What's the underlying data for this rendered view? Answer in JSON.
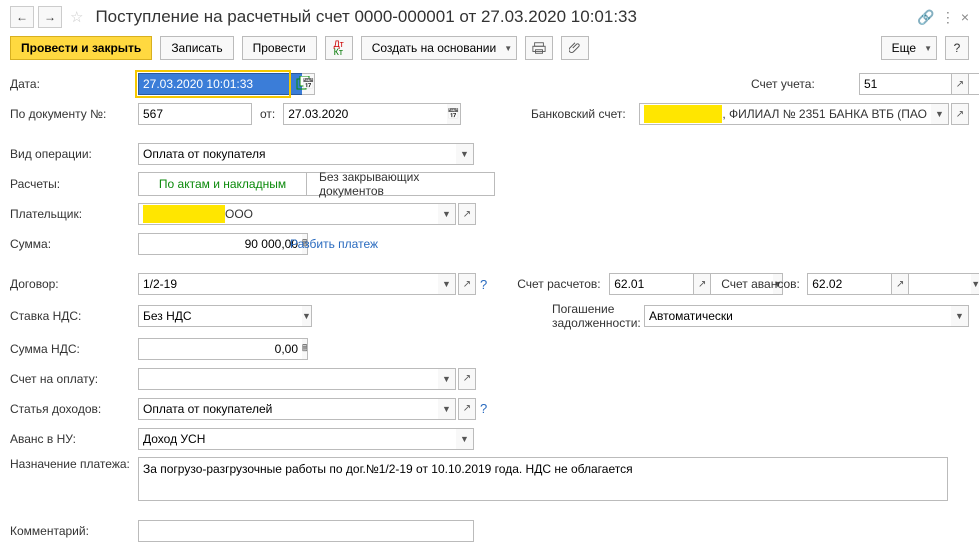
{
  "header": {
    "title": "Поступление на расчетный счет 0000-000001 от 27.03.2020 10:01:33"
  },
  "toolbar": {
    "post_close": "Провести и закрыть",
    "save": "Записать",
    "post": "Провести",
    "create_based": "Создать на основании",
    "more": "Еще"
  },
  "labels": {
    "date": "Дата:",
    "doc_no": "По документу №:",
    "from": "от:",
    "account": "Счет учета:",
    "bank_account": "Банковский счет:",
    "op_type": "Вид операции:",
    "calculations": "Расчеты:",
    "payer": "Плательщик:",
    "sum": "Сумма:",
    "contract": "Договор:",
    "vat_rate": "Ставка НДС:",
    "vat_sum": "Сумма НДС:",
    "invoice": "Счет на оплату:",
    "income_item": "Статья доходов:",
    "advance_nu": "Аванс в НУ:",
    "purpose": "Назначение платежа:",
    "comment": "Комментарий:",
    "settle_acc": "Счет расчетов:",
    "adv_acc": "Счет авансов:",
    "debt_repay": "Погашение задолженности:"
  },
  "values": {
    "date": "27.03.2020 10:01:33",
    "doc_no": "567",
    "doc_date": "27.03.2020",
    "account": "51",
    "bank_account_tail": ", ФИЛИАЛ № 2351 БАНКА ВТБ (ПАО",
    "op_type": "Оплата от покупателя",
    "calc_by_acts": "По актам и накладным",
    "calc_no_closing": "Без закрывающих документов",
    "payer_tail": "ООО",
    "sum": "90 000,00",
    "split_payment": "Разбить платеж",
    "contract": "1/2-19",
    "vat_rate": "Без НДС",
    "vat_sum": "0,00",
    "invoice": "",
    "income_item": "Оплата от покупателей",
    "advance_nu": "Доход УСН",
    "purpose": "За погрузо-разгрузочные работы по дог.№1/2-19 от 10.10.2019 года. НДС не облагается",
    "comment": "",
    "settle_acc": "62.01",
    "adv_acc": "62.02",
    "debt_repay": "Автоматически"
  }
}
